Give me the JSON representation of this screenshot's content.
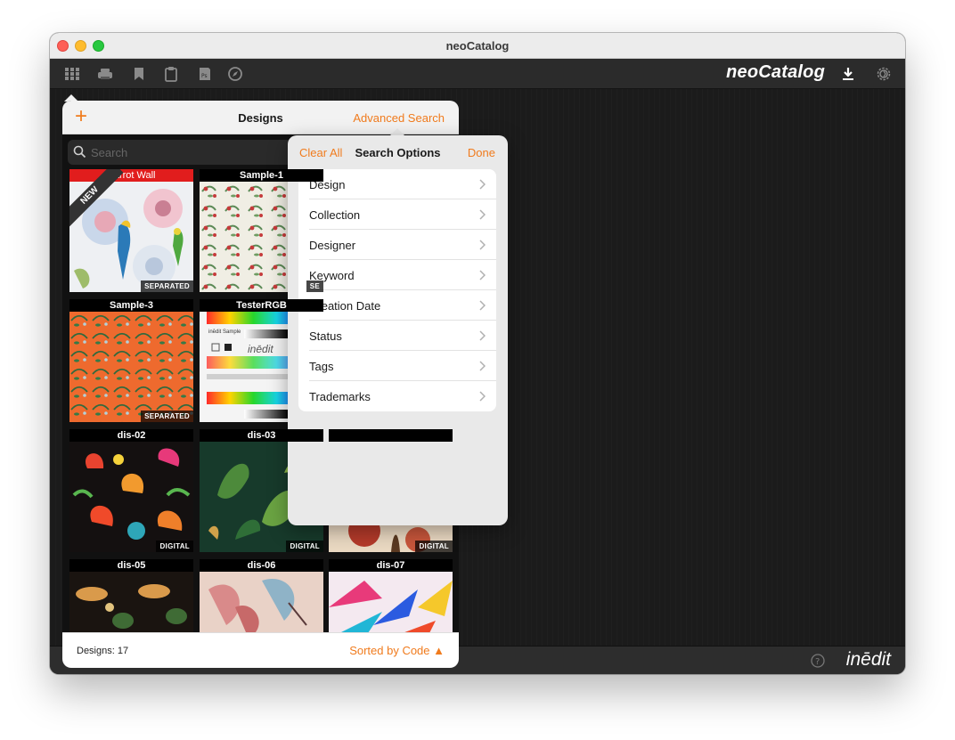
{
  "window": {
    "title": "neoCatalog"
  },
  "toolbar": {
    "icons": [
      "grid-icon",
      "printer-icon",
      "bookmark-icon",
      "clipboard-icon",
      "photoshop-icon",
      "compass-icon"
    ],
    "brand": "neoCatalog",
    "right_icons": [
      "download-icon",
      "settings-icon"
    ]
  },
  "designs_panel": {
    "add_label": "+",
    "title": "Designs",
    "advanced_search_label": "Advanced Search",
    "search_placeholder": "Search",
    "tiles": [
      {
        "name": "Parrot Wall",
        "badge": "SEPARATED",
        "ribbon": "NEW"
      },
      {
        "name": "Sample-1",
        "badge": "SE"
      },
      {
        "name": "Sample-3",
        "badge": "SEPARATED"
      },
      {
        "name": "TesterRGB",
        "badge": "",
        "sample_text": "inēdit Sample",
        "logo": "inēdit"
      },
      {
        "name": "dis-02",
        "badge": "DIGITAL"
      },
      {
        "name": "dis-03",
        "badge": "DIGITAL"
      },
      {
        "name": "",
        "badge": "DIGITAL"
      },
      {
        "name": "dis-05",
        "badge": ""
      },
      {
        "name": "dis-06",
        "badge": ""
      },
      {
        "name": "dis-07",
        "badge": ""
      }
    ],
    "footer": {
      "count_label": "Designs: 17",
      "sort_label": "Sorted by Code ▲"
    }
  },
  "search_options": {
    "clear_label": "Clear All",
    "title": "Search Options",
    "done_label": "Done",
    "items": [
      "Design",
      "Collection",
      "Designer",
      "Keyword",
      "Creation Date",
      "Status",
      "Tags",
      "Trademarks"
    ]
  },
  "statusbar": {
    "help_icon": "help-icon",
    "logo": "inēdit"
  },
  "colors": {
    "accent": "#f07b1d",
    "panel_bg": "#f2f2f2",
    "app_bg": "#1c1c1c"
  }
}
